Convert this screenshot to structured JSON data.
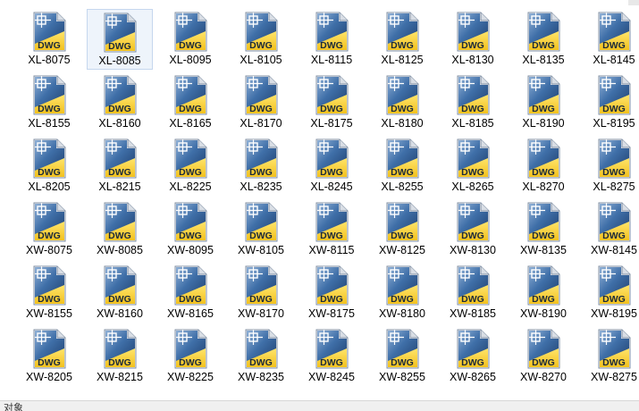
{
  "icon": {
    "name": "dwg-file-icon",
    "badge_text": "DWG",
    "colors": {
      "blue_dark": "#1f3f6e",
      "blue_mid": "#3f6fa8",
      "blue_light": "#8fb0d6",
      "yellow": "#f2c21f",
      "yellow_light": "#ffe46b",
      "page": "#f4f6f8"
    }
  },
  "selected_index": 1,
  "files": [
    "XL-8075",
    "XL-8085",
    "XL-8095",
    "XL-8105",
    "XL-8115",
    "XL-8125",
    "XL-8130",
    "XL-8135",
    "XL-8145",
    "XL-8155",
    "XL-8160",
    "XL-8165",
    "XL-8170",
    "XL-8175",
    "XL-8180",
    "XL-8185",
    "XL-8190",
    "XL-8195",
    "XL-8205",
    "XL-8215",
    "XL-8225",
    "XL-8235",
    "XL-8245",
    "XL-8255",
    "XL-8265",
    "XL-8270",
    "XL-8275",
    "XW-8075",
    "XW-8085",
    "XW-8095",
    "XW-8105",
    "XW-8115",
    "XW-8125",
    "XW-8130",
    "XW-8135",
    "XW-8145",
    "XW-8155",
    "XW-8160",
    "XW-8165",
    "XW-8170",
    "XW-8175",
    "XW-8180",
    "XW-8185",
    "XW-8190",
    "XW-8195",
    "XW-8205",
    "XW-8215",
    "XW-8225",
    "XW-8235",
    "XW-8245",
    "XW-8255",
    "XW-8265",
    "XW-8270",
    "XW-8275"
  ],
  "status_bar": {
    "text": "对象"
  }
}
